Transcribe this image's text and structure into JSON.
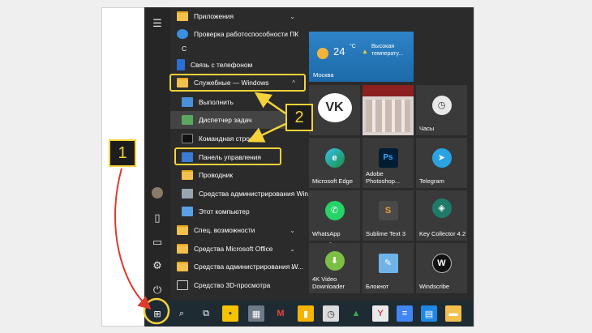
{
  "rail_icons": [
    "hamburger-icon",
    "user-avatar",
    "document-icon",
    "pictures-icon",
    "gear-icon",
    "power-icon"
  ],
  "app_list": {
    "letter_s": "С",
    "items": [
      {
        "label": "Приложения",
        "chev": "⌄"
      },
      {
        "label": "Проверка работоспособности ПК"
      },
      {
        "label": "Связь с телефоном"
      },
      {
        "label": "Служебные — Windows",
        "chev": "^"
      },
      {
        "label": "Выполнить"
      },
      {
        "label": "Диспетчер задач"
      },
      {
        "label": "Командная строка"
      },
      {
        "label": "Панель управления"
      },
      {
        "label": "Проводник"
      },
      {
        "label": "Средства администрирования Win..."
      },
      {
        "label": "Этот компьютер"
      },
      {
        "label": "Спец. возможности",
        "chev": "⌄"
      },
      {
        "label": "Средства Microsoft Office",
        "chev": "⌄"
      },
      {
        "label": "Средства администрирования W...",
        "chev": "⌄"
      },
      {
        "label": "Средство 3D-просмотра"
      }
    ]
  },
  "weather": {
    "temp": "24",
    "unit": "°C",
    "warning": "Высокая температу...",
    "city": "Москва"
  },
  "tiles": [
    {
      "label": "",
      "name": "vk-tile"
    },
    {
      "label": "",
      "name": "album-tile"
    },
    {
      "label": "Часы",
      "name": "clock-tile"
    },
    {
      "label": "Microsoft Edge",
      "name": "edge-tile"
    },
    {
      "label": "Adobe Photoshop...",
      "name": "photoshop-tile"
    },
    {
      "label": "Telegram",
      "name": "telegram-tile"
    },
    {
      "label": "WhatsApp",
      "name": "whatsapp-tile"
    },
    {
      "label": "Sublime Text 3",
      "name": "sublime-tile"
    },
    {
      "label": "Key Collector 4.2",
      "name": "keycollector-tile"
    },
    {
      "label": "4K Video Downloader",
      "name": "4kvideo-tile"
    },
    {
      "label": "Блокнот",
      "name": "notepad-tile"
    },
    {
      "label": "Windscribe",
      "name": "windscribe-tile"
    }
  ],
  "badges": {
    "one": "1",
    "two": "2"
  },
  "colors": {
    "highlight": "#f5d23a",
    "accent_arrow": "#e03a2c"
  }
}
